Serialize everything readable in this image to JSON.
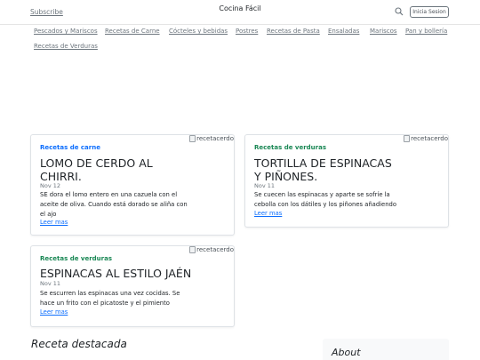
{
  "header": {
    "subscribe": "Subscribe",
    "brand": "Cocina Fácil",
    "login": "Inicia Sesion"
  },
  "nav": [
    "Pescados y Mariscos",
    "Recetas de Carne",
    "Cócteles y bebidas",
    "Postres",
    "Recetas de Pasta",
    "Ensaladas",
    "Mariscos",
    "Pan y bollería",
    "Recetas de Verduras"
  ],
  "cards": [
    {
      "category": "Recetas de carne",
      "title": "LOMO DE CERDO AL CHIRRI.",
      "date": "Nov 12",
      "excerpt": "SE dora el lomo entero en una cazuela con el aceite de oliva. Cuando está dorado se aliña con el ajo",
      "more": "Leer mas",
      "image_alt": "recetacerdo"
    },
    {
      "category": "Recetas de verduras",
      "title": "TORTILLA DE ESPINACAS Y PIÑONES.",
      "date": "Nov 11",
      "excerpt": "Se cuecen las espinacas y aparte se sofríe la cebolla con los dátiles y los piñones añadiendo",
      "more": "Leer mas",
      "image_alt": "recetacerdo"
    },
    {
      "category": "Recetas de verduras",
      "title": "ESPINACAS AL ESTILO JAÉN",
      "date": "Nov 11",
      "excerpt": "Se escurren las espinacas una vez cocidas. Se hace un frito con el picatoste y el pimiento",
      "more": "Leer mas",
      "image_alt": "recetacerdo"
    }
  ],
  "featured": "Receta destacada",
  "about": "About",
  "colors": {
    "category_blue": "#0d6efd",
    "category_green": "#198754",
    "link": "#0d6efd"
  },
  "icons": {
    "search": "search-icon",
    "broken_image": "broken-image-icon"
  }
}
